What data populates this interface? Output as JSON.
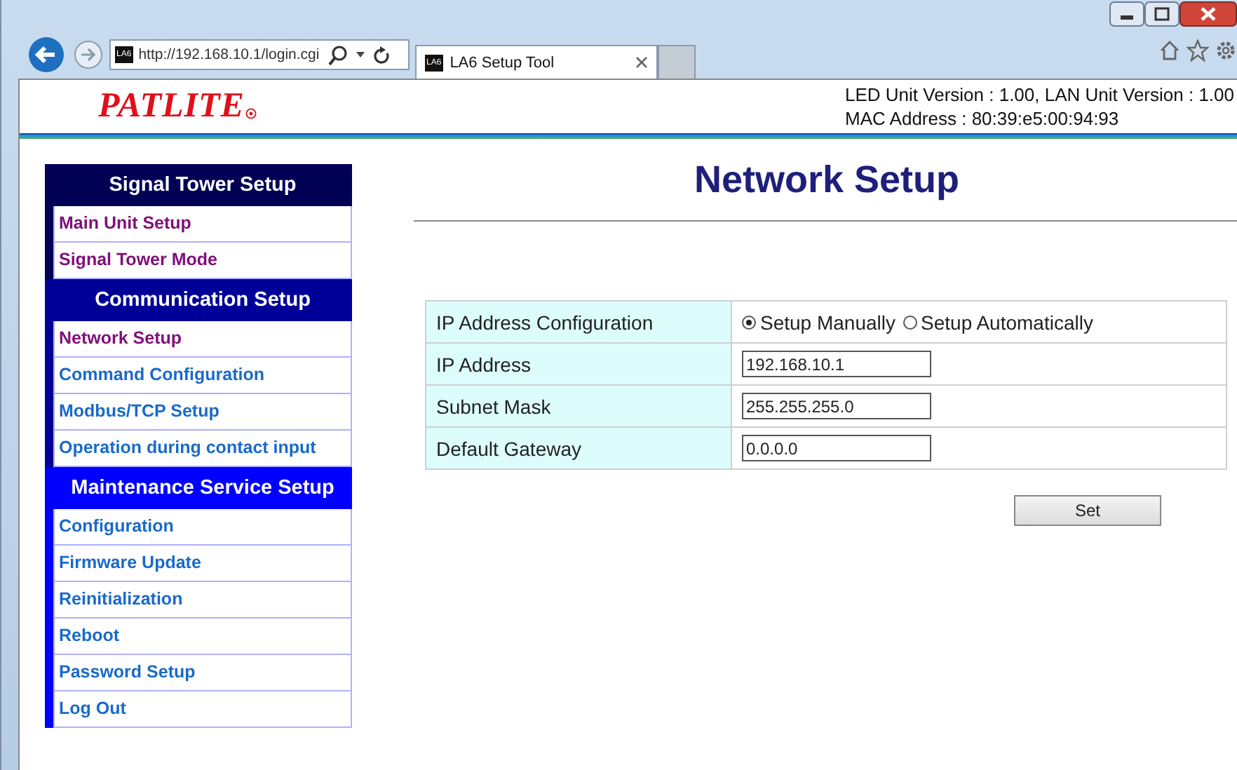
{
  "browser": {
    "address": "http://192.168.10.1/login.cgi",
    "address_favicon": "LA6",
    "tab": {
      "favicon": "LA6",
      "title": "LA6 Setup Tool",
      "selected": true
    }
  },
  "header": {
    "logo": "PATLITE",
    "version": "LED Unit Version : 1.00, LAN Unit Version : 1.00",
    "mac": "MAC Address : 80:39:e5:00:94:93"
  },
  "sidebar": {
    "sections": [
      {
        "title": "Signal Tower Setup",
        "color": "#000055",
        "items": [
          {
            "label": "Main Unit Setup",
            "visited": true
          },
          {
            "label": "Signal Tower Mode",
            "visited": true
          }
        ]
      },
      {
        "title": "Communication Setup",
        "color": "#000099",
        "items": [
          {
            "label": "Network Setup",
            "visited": true
          },
          {
            "label": "Command Configuration",
            "visited": false
          },
          {
            "label": "Modbus/TCP Setup",
            "visited": false
          },
          {
            "label": "Operation during contact input",
            "visited": false
          }
        ]
      },
      {
        "title": "Maintenance Service Setup",
        "color": "#0000ff",
        "items": [
          {
            "label": "Configuration",
            "visited": false
          },
          {
            "label": "Firmware Update",
            "visited": false
          },
          {
            "label": "Reinitialization",
            "visited": false
          },
          {
            "label": "Reboot",
            "visited": false
          },
          {
            "label": "Password Setup",
            "visited": false
          },
          {
            "label": "Log Out",
            "visited": false
          }
        ]
      }
    ]
  },
  "main": {
    "title": "Network Setup",
    "form": [
      {
        "label": "IP Address Configuration",
        "kind": "radio",
        "options": [
          {
            "label": "Setup Manually",
            "selected": true
          },
          {
            "label": "Setup Automatically",
            "selected": false
          }
        ]
      },
      {
        "label": "IP Address",
        "kind": "text",
        "value": "192.168.10.1"
      },
      {
        "label": "Subnet Mask",
        "kind": "text",
        "value": "255.255.255.0"
      },
      {
        "label": "Default Gateway",
        "kind": "text",
        "value": "0.0.0.0"
      }
    ],
    "button": "Set"
  }
}
